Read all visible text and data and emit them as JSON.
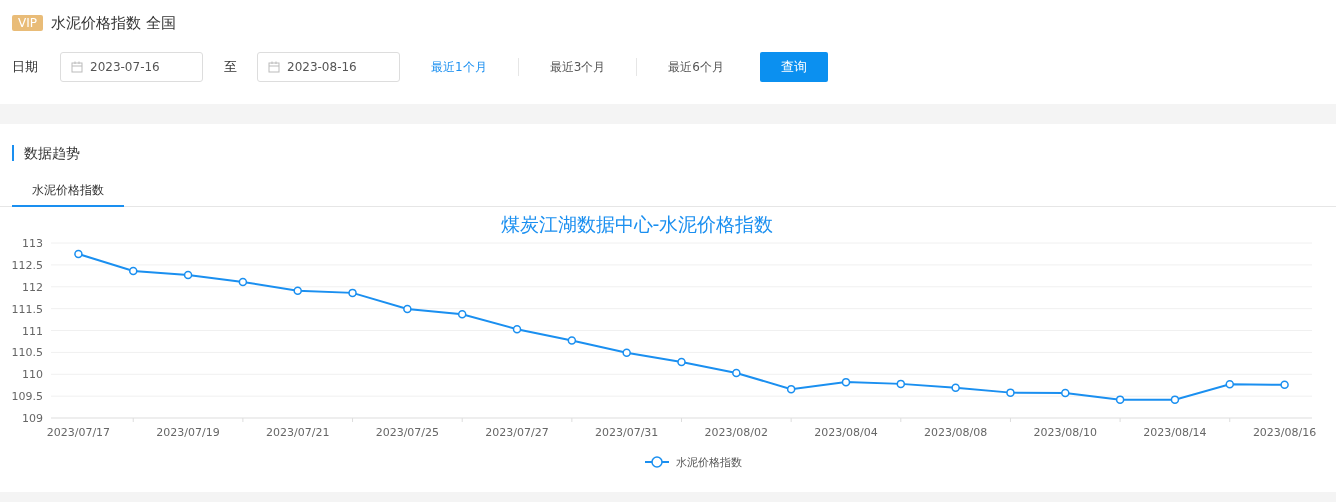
{
  "page": {
    "badge": "VIP",
    "title": "水泥价格指数 全国"
  },
  "filter": {
    "date_label": "日期",
    "start": {
      "value": "2023-07-16"
    },
    "separator": "至",
    "end": {
      "value": "2023-08-16"
    },
    "presets": [
      {
        "label": "最近1个月",
        "selected": true
      },
      {
        "label": "最近3个月",
        "selected": false
      },
      {
        "label": "最近6个月",
        "selected": false
      }
    ],
    "query_button": "查询"
  },
  "section": {
    "title": "数据趋势",
    "tabs": [
      {
        "label": "水泥价格指数",
        "selected": true
      }
    ],
    "chart_data": {
      "type": "line",
      "title": "煤炭江湖数据中心-水泥价格指数",
      "categories": [
        "2023/07/17",
        null,
        "2023/07/19",
        null,
        "2023/07/21",
        null,
        "2023/07/25",
        null,
        "2023/07/27",
        null,
        "2023/07/31",
        null,
        "2023/08/02",
        null,
        "2023/08/04",
        null,
        "2023/08/08",
        null,
        "2023/08/10",
        null,
        "2023/08/14",
        null,
        "2023/08/16"
      ],
      "ylim": [
        109,
        113
      ],
      "grid": true,
      "yticks": [
        {
          "value": 109,
          "label": "109"
        },
        {
          "value": 109.5,
          "label": "109.5"
        },
        {
          "value": 110,
          "label": "110"
        },
        {
          "value": 110.5,
          "label": "110.5"
        },
        {
          "value": 111,
          "label": "111"
        },
        {
          "value": 111.5,
          "label": "111.5"
        },
        {
          "value": 112,
          "label": "112"
        },
        {
          "value": 112.5,
          "label": "112.5"
        },
        {
          "value": 113,
          "label": "113"
        }
      ],
      "series": [
        {
          "name": "水泥价格指数",
          "color": "#1a8ff0",
          "marker": "circle",
          "values": [
            112.75,
            112.36,
            112.27,
            112.11,
            111.91,
            111.86,
            111.49,
            111.37,
            111.03,
            110.77,
            110.49,
            110.28,
            110.03,
            109.66,
            109.82,
            109.78,
            109.69,
            109.58,
            109.57,
            109.42,
            109.42,
            109.77,
            109.76
          ]
        }
      ]
    }
  }
}
